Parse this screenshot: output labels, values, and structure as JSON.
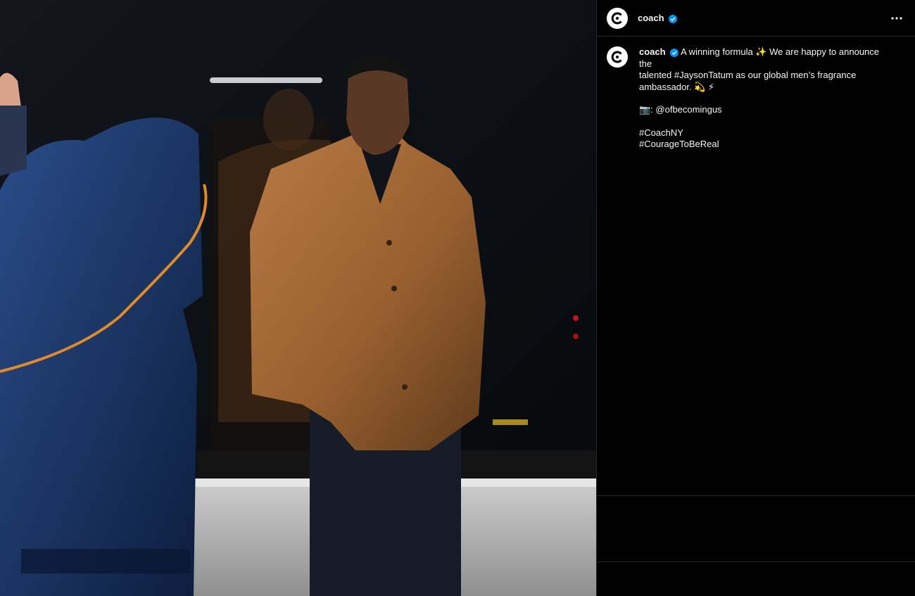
{
  "post": {
    "username": "coach",
    "verified": true,
    "caption": {
      "line1": "A winning formula ✨ We are happy to announce the",
      "line2": "talented #JaysonTatum as our global men’s fragrance",
      "line3": "ambassador. 💫 ⚡",
      "credit": "📷: @ofbecomingus",
      "hashtag1": "#CoachNY",
      "hashtag2": "#CourageToBeReal"
    }
  },
  "icons": {
    "avatar": "coach-logo-icon",
    "verified": "verified-badge-icon",
    "more": "more-options-icon"
  },
  "colors": {
    "background": "#000000",
    "text": "#f5f5f5",
    "verified": "#0095f6",
    "divider": "#262626"
  }
}
